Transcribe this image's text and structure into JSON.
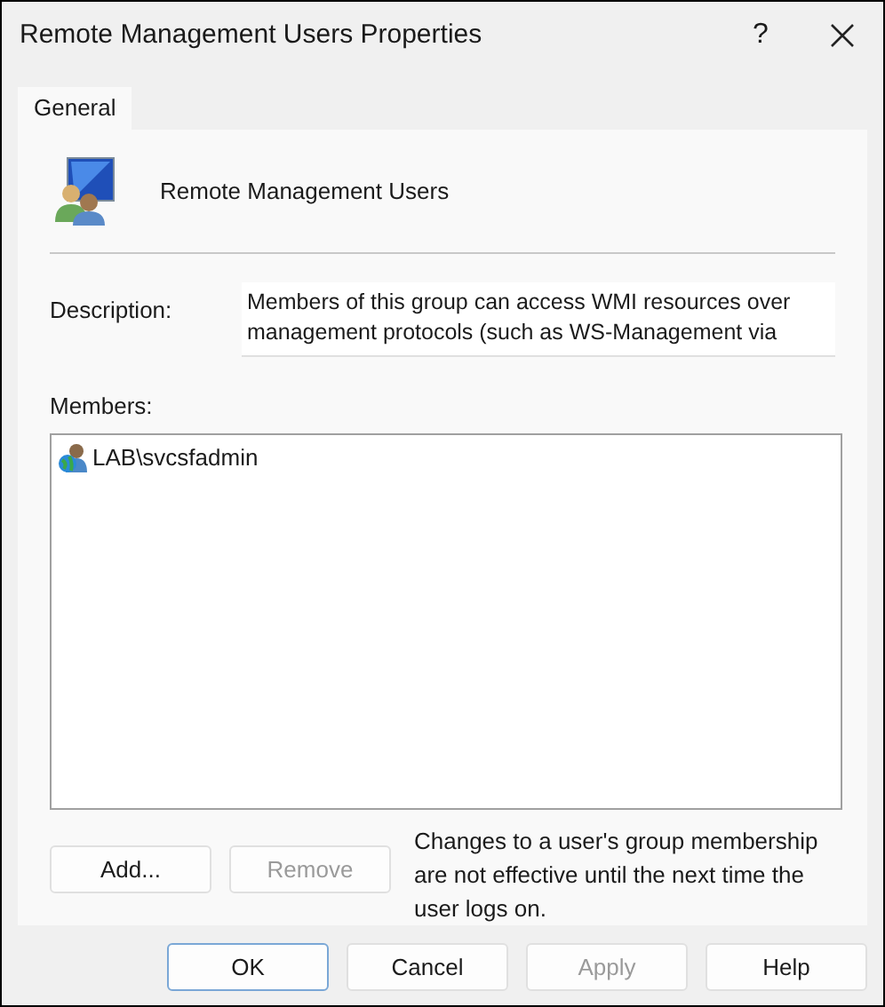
{
  "window": {
    "title": "Remote Management Users Properties",
    "help": "?"
  },
  "tabs": [
    {
      "label": "General",
      "selected": true
    }
  ],
  "group_name": "Remote Management Users",
  "description": {
    "label": "Description:",
    "value": "Members of this group can access WMI resources over management protocols (such as WS-Management via"
  },
  "members": {
    "label": "Members:",
    "items": [
      {
        "name": "LAB\\svcsfadmin",
        "selected": false
      }
    ]
  },
  "member_buttons": [
    {
      "label": "Add...",
      "disabled": false
    },
    {
      "label": "Remove",
      "disabled": true
    }
  ],
  "note": "Changes to a user's group membership are not effective until the next time the user logs on.",
  "buttons": [
    {
      "label": "OK",
      "disabled": false,
      "default": true
    },
    {
      "label": "Cancel",
      "disabled": false,
      "default": false
    },
    {
      "label": "Apply",
      "disabled": true,
      "default": false
    },
    {
      "label": "Help",
      "disabled": false,
      "default": false
    }
  ]
}
